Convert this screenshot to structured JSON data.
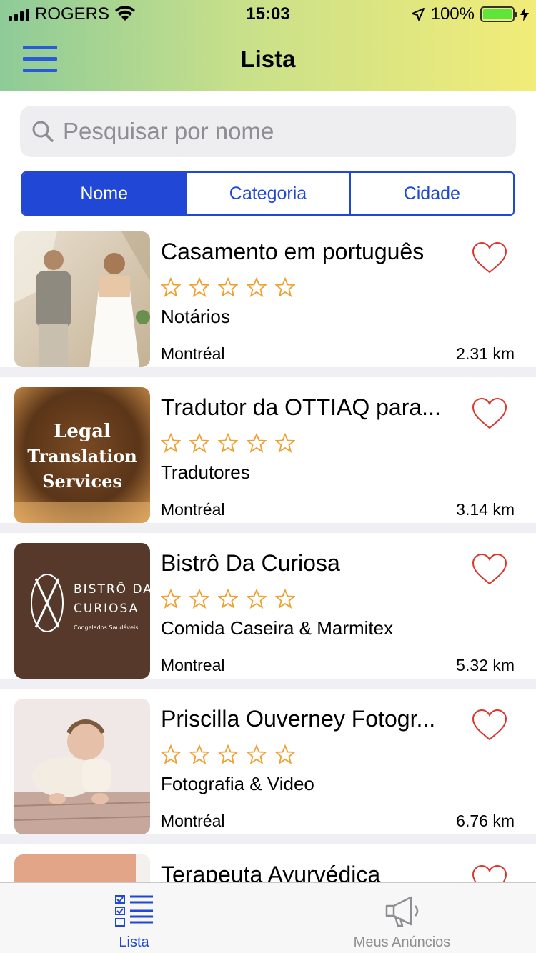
{
  "status_bar": {
    "carrier": "ROGERS",
    "time": "15:03",
    "battery": "100%"
  },
  "header": {
    "title": "Lista"
  },
  "search": {
    "placeholder": "Pesquisar por nome",
    "value": ""
  },
  "segments": [
    {
      "label": "Nome",
      "active": true
    },
    {
      "label": "Categoria",
      "active": false
    },
    {
      "label": "Cidade",
      "active": false
    }
  ],
  "listings": [
    {
      "title": "Casamento em português",
      "category": "Notários",
      "city": "Montréal",
      "distance": "2.31 km",
      "rating": 0,
      "image": "wedding-couple-photo"
    },
    {
      "title": "Tradutor da OTTIAQ para...",
      "category": "Tradutores",
      "city": "Montréal",
      "distance": "3.14 km",
      "rating": 0,
      "image": "legal-translation-photo",
      "image_text": [
        "Legal",
        "Translation",
        "Services"
      ]
    },
    {
      "title": "Bistrô Da Curiosa",
      "category": "Comida Caseira & Marmitex",
      "city": "Montreal",
      "distance": "5.32 km",
      "rating": 0,
      "image": "bistro-logo",
      "image_text": [
        "BISTRÔ DA",
        "CURIOSA",
        "Congelados Saudáveis"
      ]
    },
    {
      "title": "Priscilla Ouverney Fotogr...",
      "category": "Fotografia & Video",
      "city": "Montréal",
      "distance": "6.76 km",
      "rating": 0,
      "image": "baby-photo"
    },
    {
      "title": "Terapeuta Ayurvédica",
      "category": "",
      "city": "",
      "distance": "",
      "rating": 0,
      "image": "skin-photo"
    }
  ],
  "tabbar": {
    "tabs": [
      {
        "label": "Lista",
        "icon": "checklist-icon",
        "active": true
      },
      {
        "label": "Meus Anúncios",
        "icon": "megaphone-icon",
        "active": false
      }
    ]
  },
  "colors": {
    "accent": "#2047d6",
    "star": "#f0a030",
    "heart": "#d9362f"
  }
}
